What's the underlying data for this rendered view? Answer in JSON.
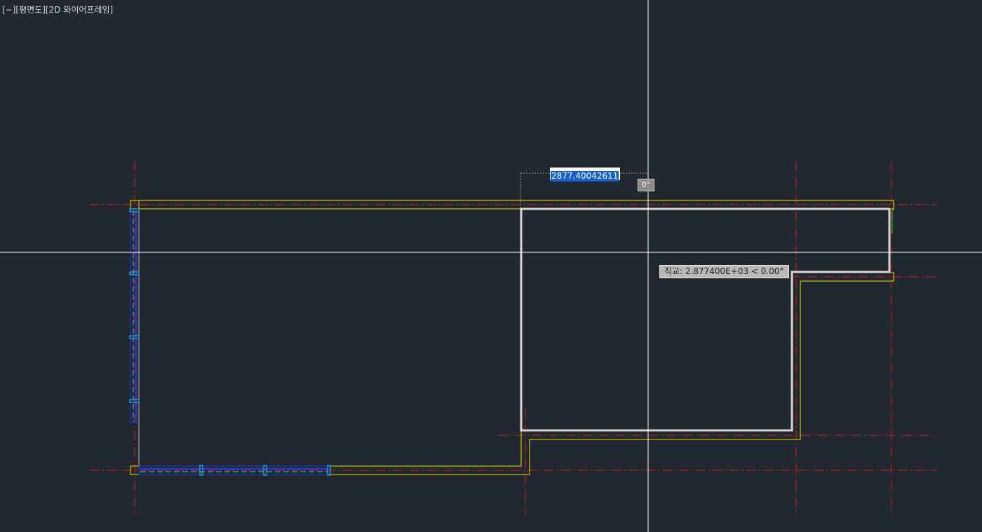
{
  "viewport": {
    "label": "[−][평면도][2D 와이어프레임]"
  },
  "dynamic_input": {
    "distance_value": "2877.40042611",
    "angle_value": "0°"
  },
  "tracking_tooltip": {
    "text": "직교: 2.877400E+03 < 0.00°"
  },
  "colors": {
    "background": "#212830",
    "crosshair": "#ffffff",
    "grid_axis": "#d21e1e",
    "wall_outline": "#e6e600",
    "polyline": "#d7d7d7",
    "window_frame": "#1e3cdc",
    "window_mullion": "#28c8ff",
    "selection_accent": "#1560c8"
  }
}
